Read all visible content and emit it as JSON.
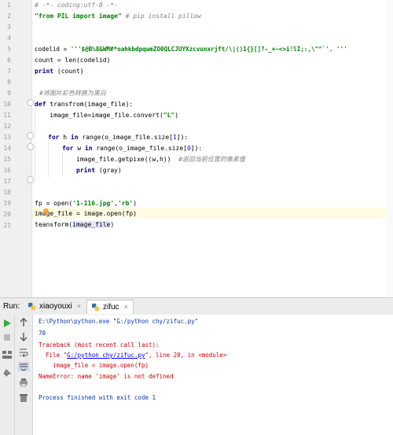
{
  "editor": {
    "line_numbers": [
      "1",
      "2",
      "3",
      "4",
      "5",
      "6",
      "7",
      "8",
      "9",
      "10",
      "11",
      "12",
      "13",
      "14",
      "15",
      "16",
      "17",
      "18",
      "19",
      "20",
      "21"
    ],
    "code": {
      "l1": "# -*- coding:utf-8 -*-",
      "l2_str": "\"from PIL import image\"",
      "l2_com": " # pip install pillow",
      "l5_pre": "codelid = ",
      "l5_str": "'''$@B%8&WM#*oahkbdpqwmZO0QLCJUYXzcvunxrjft/\\|()1{}[]?-_+~<>i!lI;:,\\\"^`'. '''",
      "l6": "count = len(codelid)",
      "l7_kw": "print",
      "l7_rest": " (count)",
      "l9": "#将图片彩色转换为黑白",
      "l10_kw": "def",
      "l10_rest": " transfrom(image_file):",
      "l11_pre": "    image_file=image_file.convert(",
      "l11_str": "\"L\"",
      "l11_post": ")",
      "l13_kw1": "for",
      "l13_a": " h ",
      "l13_kw2": "in",
      "l13_b": " range(o_image_file.size[",
      "l13_num": "1",
      "l13_c": "]):",
      "l14_kw1": "for",
      "l14_a": " w ",
      "l14_kw2": "in",
      "l14_b": " range(o_image_file.size[",
      "l14_num": "0",
      "l14_c": "]):",
      "l15_pre": "image_file.getpixe((w,h))  ",
      "l15_com": "#返回当前位置的像素值",
      "l16_kw": "print",
      "l16_rest": " (gray)",
      "l19_pre": "fp = open(",
      "l19_s1": "'1-116.jpg'",
      "l19_mid": ",",
      "l19_s2": "'rb'",
      "l19_post": ")",
      "l20": "image_file = image.open(fp)",
      "l21_pre": "teansform(",
      "l21_sel": "image_file",
      "l21_post": ")"
    }
  },
  "run": {
    "label": "Run:",
    "tabs": [
      {
        "label": "xiaoyouxi",
        "close": "×"
      },
      {
        "label": "zifuc",
        "close": "×"
      }
    ],
    "console": {
      "cmd": "E:\\Python\\python.exe \"G:/python chy/zifuc.py\"",
      "out": "70",
      "tb": "Traceback (most recent call last):",
      "file_pre": "  File \"",
      "file_link": "G:/python chy/zifuc.py",
      "file_post": "\", line 20, in <module>",
      "code": "    image_file = image.open(fp)",
      "err": "NameError: name 'image' is not defined",
      "exit": "Process finished with exit code 1"
    }
  }
}
